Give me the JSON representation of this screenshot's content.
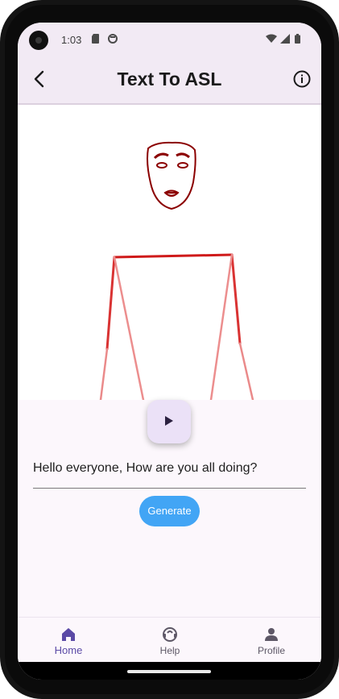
{
  "status_bar": {
    "time": "1:03",
    "left_icons": [
      "sd-card-icon",
      "face-icon"
    ],
    "right_icons": [
      "wifi-icon",
      "signal-icon",
      "battery-icon"
    ]
  },
  "app_bar": {
    "title": "Text To ASL",
    "back_icon": "back-arrow-icon",
    "info_icon": "info-icon"
  },
  "animation": {
    "description_icons": [
      "avatar-face",
      "avatar-body"
    ],
    "play_icon": "play-icon"
  },
  "input": {
    "value": "Hello everyone, How are you all doing?"
  },
  "generate_button": {
    "label": "Generate",
    "color": "#42a5f5"
  },
  "bottom_nav": {
    "items": [
      {
        "label": "Home",
        "icon": "home-icon",
        "active": true
      },
      {
        "label": "Help",
        "icon": "help-icon",
        "active": false
      },
      {
        "label": "Profile",
        "icon": "profile-icon",
        "active": false
      }
    ],
    "accent": "#5b4aa6"
  }
}
